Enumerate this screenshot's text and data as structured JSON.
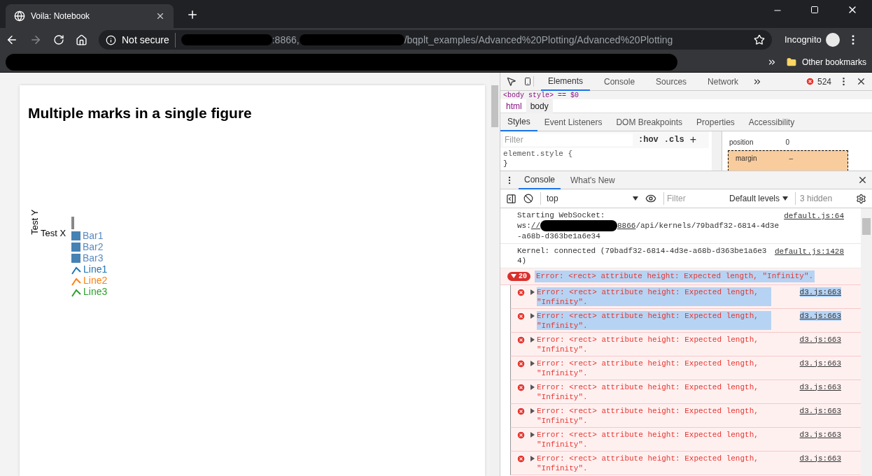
{
  "browser": {
    "tab_title": "Voila: Notebook",
    "security": "Not secure",
    "url_parts": [
      {
        "kind": "redacted"
      },
      {
        "kind": "text",
        "text": ":8866,"
      },
      {
        "kind": "redacted"
      },
      {
        "kind": "text",
        "text": "/bqplt_examples/Advanced%20Plotting/Advanced%20Plotting"
      }
    ],
    "profile": "Incognito",
    "bookmarks": [
      {
        "kind": "redacted"
      },
      {
        "kind": "folder",
        "text": "Other bookmarks"
      }
    ]
  },
  "page": {
    "title": "Multiple marks in a single figure",
    "y_label": "Test Y",
    "x_label": "Test X",
    "legend": [
      {
        "kind": "bar",
        "label": "Bar1",
        "color": "#4682b4"
      },
      {
        "kind": "bar",
        "label": "Bar2",
        "color": "#4682b4"
      },
      {
        "kind": "bar",
        "label": "Bar3",
        "color": "#4682b4"
      },
      {
        "kind": "line",
        "label": "Line1",
        "color": "#1f77b4"
      },
      {
        "kind": "line",
        "label": "Line2",
        "color": "#ff7f0e"
      },
      {
        "kind": "line",
        "label": "Line3",
        "color": "#2ca02c"
      }
    ]
  },
  "devtools": {
    "tabs": [
      {
        "label": "Elements",
        "selected": true
      },
      {
        "label": "Console",
        "selected": false
      },
      {
        "label": "Sources",
        "selected": false
      },
      {
        "label": "Network",
        "selected": false
      }
    ],
    "error_count": "524",
    "dom_line": "<body style> == $0",
    "breadcrumbs": [
      {
        "label": "html",
        "selected": false
      },
      {
        "label": "body",
        "selected": true
      }
    ],
    "style_tabs": [
      {
        "label": "Styles",
        "selected": true
      },
      {
        "label": "Event Listeners",
        "selected": false
      },
      {
        "label": "DOM Breakpoints",
        "selected": false
      },
      {
        "label": "Properties",
        "selected": false
      },
      {
        "label": "Accessibility",
        "selected": false
      }
    ],
    "filter_placeholder": "Filter",
    "hov": ":hov",
    "cls": ".cls",
    "plus": "+",
    "rule": "element.style {",
    "rule_end": "}",
    "box_position": "position",
    "box_position_value": "0",
    "box_margin": "margin",
    "box_margin_value": "–",
    "drawer_tabs": [
      {
        "label": "Console",
        "selected": true
      },
      {
        "label": "What's New",
        "selected": false
      }
    ],
    "context": "top",
    "console_filter_placeholder": "Filter",
    "levels": "Default levels",
    "hidden": "3 hidden",
    "messages": [
      {
        "kind": "info",
        "parts": [
          {
            "kind": "text",
            "text": "Starting WebSocket:\nws:"
          },
          {
            "kind": "link",
            "text": "//"
          },
          {
            "kind": "redacted"
          },
          {
            "kind": "link",
            "text": "8866"
          },
          {
            "kind": "text",
            "text": "/api/kernels/79badf32-6814-4d3e-a68b-d363be1a6e34"
          }
        ],
        "source": "default.js:64"
      },
      {
        "kind": "info",
        "parts": [
          {
            "kind": "text",
            "text": "Kernel: connected (79badf32-6814-4d3e-a68b-d363be1a6e34)"
          }
        ],
        "source": "default.js:1428"
      },
      {
        "kind": "group",
        "count": "20",
        "text": "Error: <rect> attribute height: Expected length, \"Infinity\".",
        "selected": true
      },
      {
        "kind": "error",
        "text": "Error: <rect> attribute height: Expected length, \"Infinity\".",
        "source": "d3.js:663",
        "selected": true
      },
      {
        "kind": "error",
        "text": "Error: <rect> attribute height: Expected length, \"Infinity\".",
        "source": "d3.js:663",
        "selected": true
      },
      {
        "kind": "error",
        "text": "Error: <rect> attribute height: Expected length, \"Infinity\".",
        "source": "d3.js:663",
        "selected": false
      },
      {
        "kind": "error",
        "text": "Error: <rect> attribute height: Expected length, \"Infinity\".",
        "source": "d3.js:663",
        "selected": false
      },
      {
        "kind": "error",
        "text": "Error: <rect> attribute height: Expected length, \"Infinity\".",
        "source": "d3.js:663",
        "selected": false
      },
      {
        "kind": "error",
        "text": "Error: <rect> attribute height: Expected length, \"Infinity\".",
        "source": "d3.js:663",
        "selected": false
      },
      {
        "kind": "error",
        "text": "Error: <rect> attribute height: Expected length, \"Infinity\".",
        "source": "d3.js:663",
        "selected": false
      },
      {
        "kind": "error",
        "text": "Error: <rect> attribute height: Expected length, \"Infinity\".",
        "source": "d3.js:663",
        "selected": false
      }
    ]
  }
}
